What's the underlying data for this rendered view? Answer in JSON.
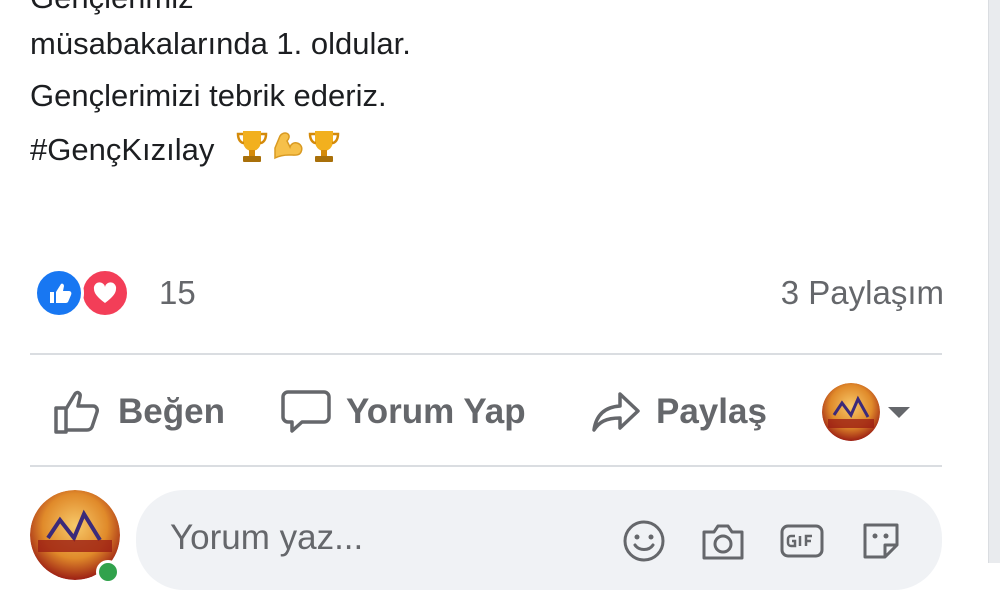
{
  "post": {
    "partial_line": "Gençlerimiz",
    "line1": "müsabakalarında 1. oldular.",
    "line2": "Gençlerimizi tebrik ederiz.",
    "hashtag": "#GençKızılay",
    "emojis": [
      "trophy-icon",
      "flexed-biceps-icon",
      "trophy-icon"
    ]
  },
  "reactions": {
    "types": [
      "like",
      "love"
    ],
    "count": "15",
    "shares": "3 Paylaşım"
  },
  "actions": {
    "like": "Beğen",
    "comment": "Yorum Yap",
    "share": "Paylaş"
  },
  "composer": {
    "placeholder": "Yorum yaz...",
    "tools": [
      "smile-icon",
      "camera-icon",
      "gif-icon",
      "sticker-icon"
    ]
  },
  "colors": {
    "like_blue": "#1877f2",
    "love_red": "#f33e58",
    "muted_text": "#65676b",
    "divider": "#dadde1",
    "composer_bg": "#f0f2f5",
    "online_green": "#31a24c"
  }
}
